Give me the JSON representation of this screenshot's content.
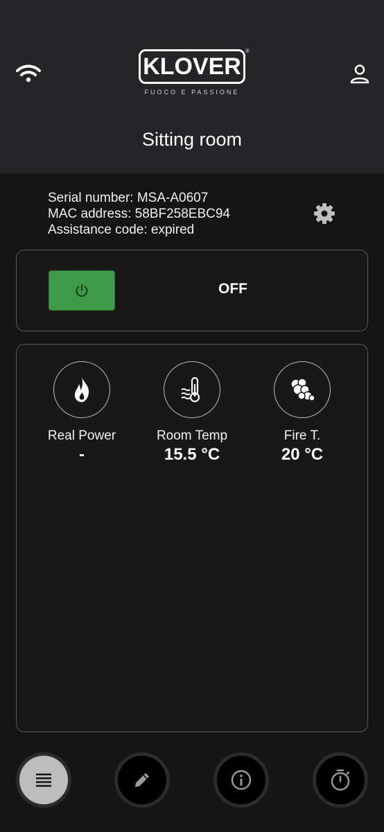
{
  "header": {
    "logo_word": "KLOVER",
    "logo_reg": "®",
    "logo_tagline": "FUOCO E PASSIONE",
    "room_name": "Sitting room",
    "icons": {
      "left": "wifi-icon",
      "right": "user-icon"
    }
  },
  "device": {
    "serial_line": "Serial number: MSA-A0607",
    "mac_line": "MAC address: 58BF258EBC94",
    "assistance_line": "Assistance code: expired",
    "settings_icon": "gear-icon"
  },
  "power": {
    "status": "OFF",
    "button_color": "#3e9a46"
  },
  "stats": [
    {
      "icon": "flame-icon",
      "label": "Real Power",
      "value": "-"
    },
    {
      "icon": "thermometer-icon",
      "label": "Room Temp",
      "value": "15.5 °C"
    },
    {
      "icon": "smoke-icon",
      "label": "Fire T.",
      "value": "20 °C"
    }
  ],
  "bottom_nav": [
    {
      "icon": "list-icon",
      "active": true
    },
    {
      "icon": "pencil-icon",
      "active": false
    },
    {
      "icon": "info-icon",
      "active": false
    },
    {
      "icon": "stopwatch-icon",
      "active": false
    }
  ],
  "colors": {
    "background": "#151515",
    "header": "#252528",
    "card_border": "#5a5a5a",
    "active_nav": "#bdbdbd"
  }
}
